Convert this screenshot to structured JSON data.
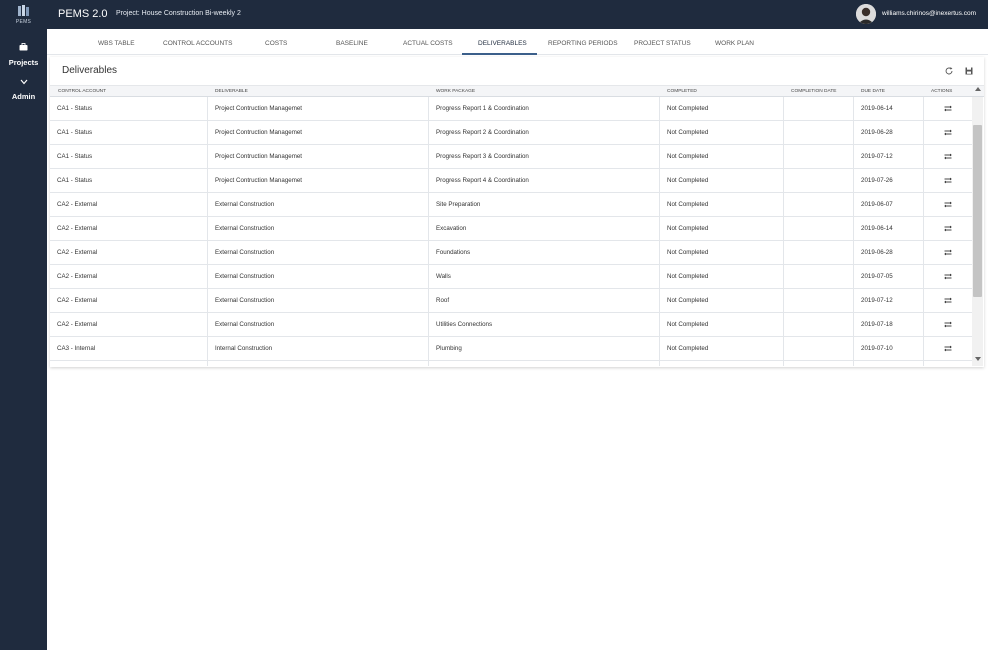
{
  "app": {
    "logo_text": "PEMS",
    "title": "PEMS 2.0",
    "project_title": "Project: House Construction Bi-weekly 2",
    "user_email": "williams.chirinos@inexertus.com"
  },
  "sidebar": {
    "items": [
      {
        "label": "Projects",
        "icon": "briefcase-icon"
      },
      {
        "label": "Admin",
        "icon": "chevron-down-icon"
      }
    ]
  },
  "tabs": [
    {
      "label": "WBS TABLE"
    },
    {
      "label": "CONTROL ACCOUNTS"
    },
    {
      "label": "COSTS"
    },
    {
      "label": "BASELINE"
    },
    {
      "label": "ACTUAL COSTS"
    },
    {
      "label": "DELIVERABLES",
      "active": true
    },
    {
      "label": "REPORTING PERIODS"
    },
    {
      "label": "PROJECT STATUS"
    },
    {
      "label": "WORK PLAN"
    }
  ],
  "panel": {
    "title": "Deliverables",
    "icons": [
      "refresh-icon",
      "save-icon"
    ]
  },
  "grid": {
    "columns": [
      "CONTROL ACCOUNT",
      "DELIVERABLE",
      "WORK PACKAGE",
      "COMPLETED",
      "COMPLETION DATE",
      "DUE DATE",
      "ACTIONS"
    ],
    "rows": [
      {
        "control_account": "CA1 - Status",
        "deliverable": "Project Contruction Managemet",
        "work_package": "Progress Report 1 & Coordination",
        "completed": "Not Completed",
        "completion_date": "",
        "due_date": "2019-06-14"
      },
      {
        "control_account": "CA1 - Status",
        "deliverable": "Project Contruction Managemet",
        "work_package": "Progress Report 2 & Coordination",
        "completed": "Not Completed",
        "completion_date": "",
        "due_date": "2019-06-28"
      },
      {
        "control_account": "CA1 - Status",
        "deliverable": "Project Contruction Managemet",
        "work_package": "Progress Report 3 & Coordination",
        "completed": "Not Completed",
        "completion_date": "",
        "due_date": "2019-07-12"
      },
      {
        "control_account": "CA1 - Status",
        "deliverable": "Project Contruction Managemet",
        "work_package": "Progress Report 4 & Coordination",
        "completed": "Not Completed",
        "completion_date": "",
        "due_date": "2019-07-26"
      },
      {
        "control_account": "CA2 - External",
        "deliverable": "External Construction",
        "work_package": "Site Preparation",
        "completed": "Not Completed",
        "completion_date": "",
        "due_date": "2019-06-07"
      },
      {
        "control_account": "CA2 - External",
        "deliverable": "External Construction",
        "work_package": "Excavation",
        "completed": "Not Completed",
        "completion_date": "",
        "due_date": "2019-06-14"
      },
      {
        "control_account": "CA2 - External",
        "deliverable": "External Construction",
        "work_package": "Foundations",
        "completed": "Not Completed",
        "completion_date": "",
        "due_date": "2019-06-28"
      },
      {
        "control_account": "CA2 - External",
        "deliverable": "External Construction",
        "work_package": "Walls",
        "completed": "Not Completed",
        "completion_date": "",
        "due_date": "2019-07-05"
      },
      {
        "control_account": "CA2 - External",
        "deliverable": "External Construction",
        "work_package": "Roof",
        "completed": "Not Completed",
        "completion_date": "",
        "due_date": "2019-07-12"
      },
      {
        "control_account": "CA2 - External",
        "deliverable": "External Construction",
        "work_package": "Utilities Connections",
        "completed": "Not Completed",
        "completion_date": "",
        "due_date": "2019-07-18"
      },
      {
        "control_account": "CA3 - Internal",
        "deliverable": "Internal Construction",
        "work_package": "Plumbing",
        "completed": "Not Completed",
        "completion_date": "",
        "due_date": "2019-07-10"
      },
      {
        "control_account": "",
        "deliverable": "",
        "work_package": "",
        "completed": "",
        "completion_date": "",
        "due_date": ""
      }
    ]
  },
  "colors": {
    "sidebar_bg": "#1f2b3e",
    "active_tab_underline": "#3b5f8a"
  }
}
